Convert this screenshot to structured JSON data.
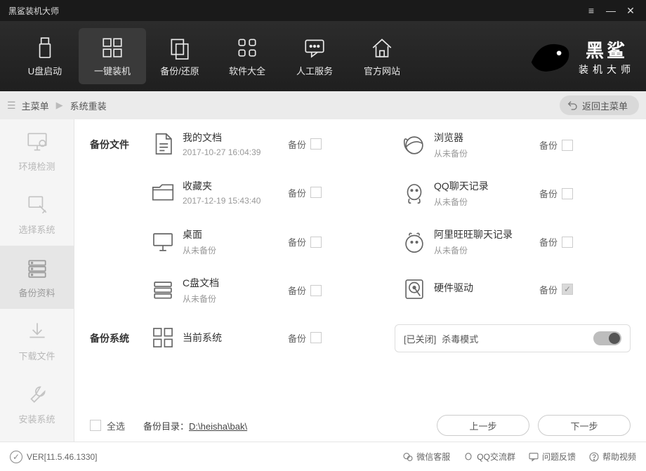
{
  "window": {
    "title": "黑鲨装机大师"
  },
  "brand": {
    "line1": "黑鲨",
    "line2": "装机大师"
  },
  "nav": [
    {
      "id": "usb",
      "label": "U盘启动"
    },
    {
      "id": "reinstall",
      "label": "一键装机",
      "active": true
    },
    {
      "id": "backup",
      "label": "备份/还原"
    },
    {
      "id": "software",
      "label": "软件大全"
    },
    {
      "id": "support",
      "label": "人工服务"
    },
    {
      "id": "website",
      "label": "官方网站"
    }
  ],
  "breadcrumb": {
    "root": "主菜单",
    "current": "系统重装",
    "back": "返回主菜单"
  },
  "steps": [
    {
      "id": "env",
      "label": "环境检测"
    },
    {
      "id": "sys",
      "label": "选择系统"
    },
    {
      "id": "data",
      "label": "备份资料",
      "active": true
    },
    {
      "id": "dl",
      "label": "下载文件"
    },
    {
      "id": "inst",
      "label": "安装系统"
    }
  ],
  "sections": {
    "files_label": "备份文件",
    "system_label": "备份系统",
    "backup_word": "备份",
    "items": {
      "docs": {
        "title": "我的文档",
        "sub": "2017-10-27 16:04:39",
        "checked": false
      },
      "browser": {
        "title": "浏览器",
        "sub": "从未备份",
        "checked": false
      },
      "fav": {
        "title": "收藏夹",
        "sub": "2017-12-19 15:43:40",
        "checked": false
      },
      "qq": {
        "title": "QQ聊天记录",
        "sub": "从未备份",
        "checked": false
      },
      "desktop": {
        "title": "桌面",
        "sub": "从未备份",
        "checked": false
      },
      "aliww": {
        "title": "阿里旺旺聊天记录",
        "sub": "从未备份",
        "checked": false
      },
      "cdrive": {
        "title": "C盘文档",
        "sub": "从未备份",
        "checked": false
      },
      "driver": {
        "title": "硬件驱动",
        "sub": "",
        "checked": true
      },
      "cursys": {
        "title": "当前系统",
        "sub": "",
        "checked": false
      }
    },
    "antivirus": {
      "status_prefix": "[已关闭]",
      "label": "杀毒模式",
      "on": false
    }
  },
  "footer": {
    "select_all": "全选",
    "path_label": "备份目录：",
    "path": "D:\\heisha\\bak\\",
    "prev": "上一步",
    "next": "下一步"
  },
  "status": {
    "version": "VER[11.5.46.1330]",
    "links": [
      {
        "id": "wechat",
        "label": "微信客服"
      },
      {
        "id": "qqgrp",
        "label": "QQ交流群"
      },
      {
        "id": "feedback",
        "label": "问题反馈"
      },
      {
        "id": "help",
        "label": "帮助视频"
      }
    ]
  }
}
